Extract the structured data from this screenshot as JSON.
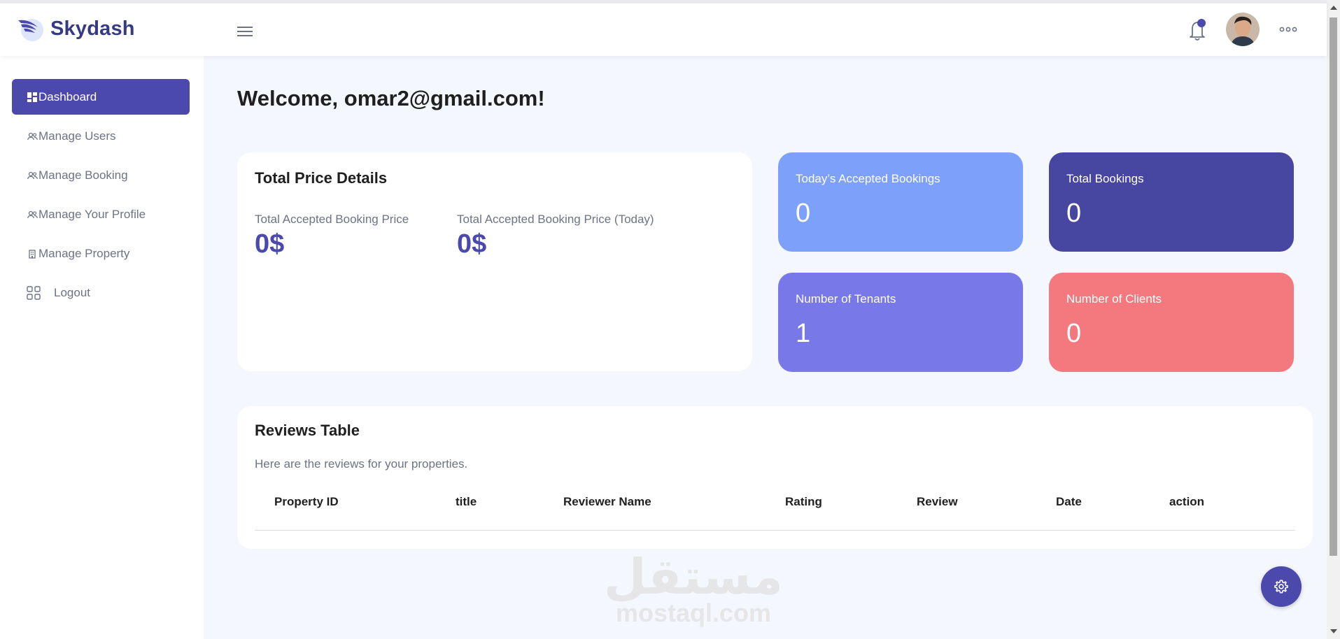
{
  "brand": {
    "name": "Skydash"
  },
  "sidebar": {
    "items": [
      {
        "label": "Dashboard",
        "icon": "dashboard-icon"
      },
      {
        "label": "Manage Users",
        "icon": "users-icon"
      },
      {
        "label": "Manage Booking",
        "icon": "users-icon"
      },
      {
        "label": "Manage Your Profile",
        "icon": "users-icon"
      },
      {
        "label": "Manage Property",
        "icon": "building-icon"
      },
      {
        "label": "Logout",
        "icon": "grid-icon"
      }
    ]
  },
  "main": {
    "welcome": "Welcome, omar2@gmail.com!",
    "price_card": {
      "title": "Total Price Details",
      "items": [
        {
          "label": "Total Accepted Booking Price",
          "value": "0$"
        },
        {
          "label": "Total Accepted Booking Price (Today)",
          "value": "0$"
        }
      ]
    },
    "stats": [
      {
        "label": "Today’s Accepted Bookings",
        "value": "0",
        "color": "#7da0fa"
      },
      {
        "label": "Total Bookings",
        "value": "0",
        "color": "#4747a1"
      },
      {
        "label": "Number of Tenants",
        "value": "1",
        "color": "#7978e9"
      },
      {
        "label": "Number of Clients",
        "value": "0",
        "color": "#f3797e"
      }
    ],
    "reviews": {
      "title": "Reviews Table",
      "subtitle": "Here are the reviews for your properties.",
      "columns": [
        "Property ID",
        "title",
        "Reviewer Name",
        "Rating",
        "Review",
        "Date",
        "action"
      ]
    }
  },
  "watermark": {
    "arabic": "مستقل",
    "latin": "mostaql.com"
  },
  "colors": {
    "accent": "#4b49ac",
    "background": "#f4f7fd"
  }
}
